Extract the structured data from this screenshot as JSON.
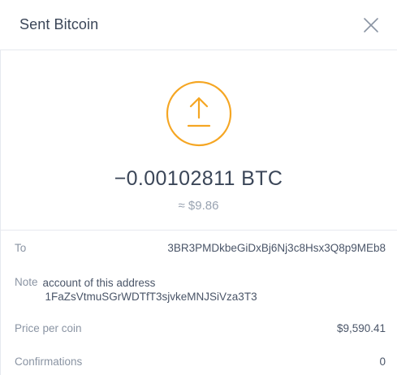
{
  "header": {
    "title": "Sent Bitcoin",
    "close_icon": "close-icon"
  },
  "hero": {
    "icon": "send-arrow-up-icon",
    "icon_color": "#f5a623",
    "amount": "−0.00102811 BTC",
    "fiat": "≈ $9.86"
  },
  "details": {
    "to_label": "To",
    "to_value": "3BR3PMDkbeGiDxBj6Nj3c8Hsx3Q8p9MEb8",
    "note_label": "Note",
    "note_line1": "account of this address",
    "note_line2": "1FaZsVtmuSGrWDTfT3sjvkeMNJSiVza3T3",
    "price_label": "Price per coin",
    "price_value": "$9,590.41",
    "confirmations_label": "Confirmations",
    "confirmations_value": "0"
  },
  "colors": {
    "accent": "#f5a623",
    "text_dark": "#3b4658",
    "text_muted": "#8a94a3",
    "divider": "#e6e9ef"
  }
}
